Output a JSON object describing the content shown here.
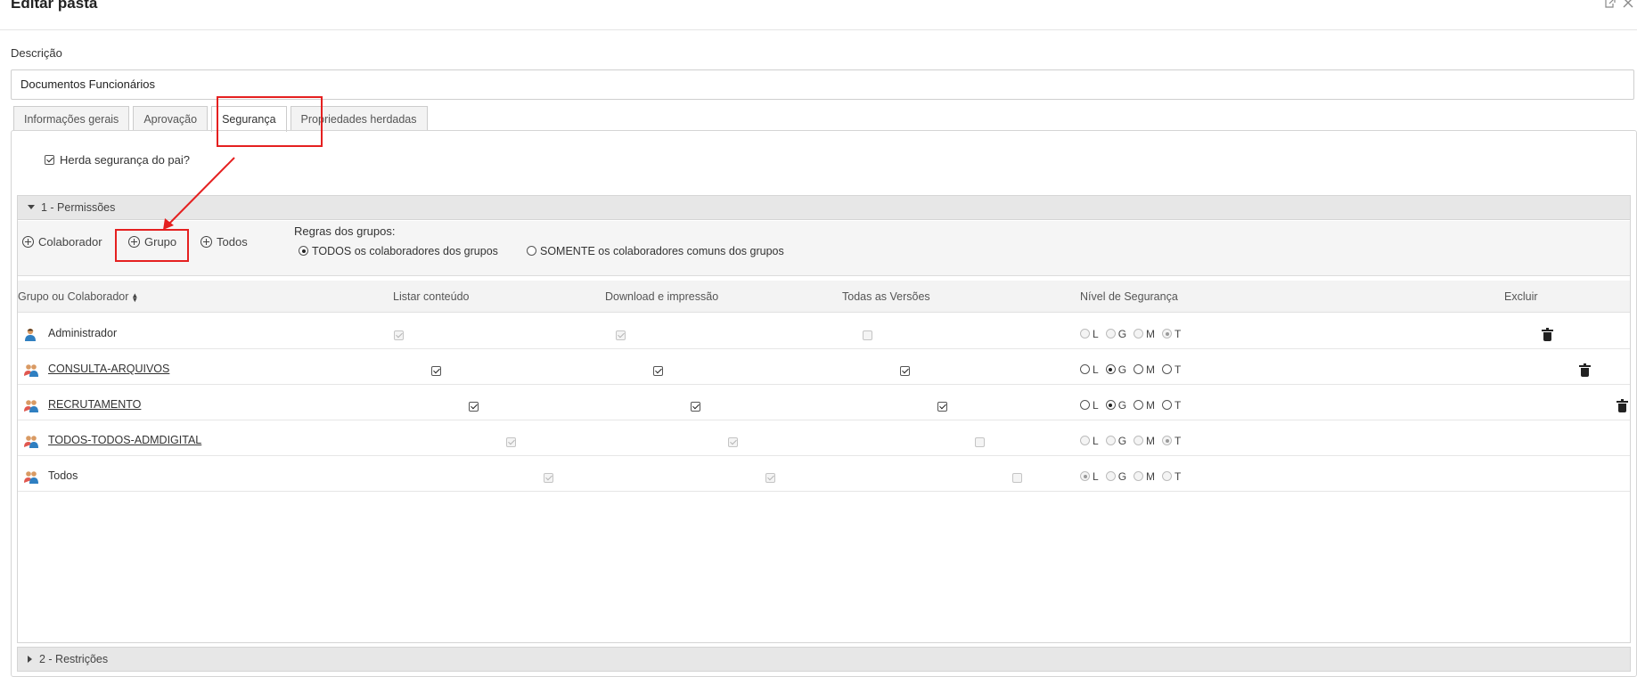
{
  "window": {
    "title": "Editar pasta",
    "icons": [
      "popout-icon",
      "close-icon"
    ]
  },
  "description": {
    "label": "Descrição",
    "value": "Documentos Funcionários"
  },
  "tabs": [
    {
      "label": "Informações gerais",
      "active": false
    },
    {
      "label": "Aprovação",
      "active": false
    },
    {
      "label": "Segurança",
      "active": true
    },
    {
      "label": "Propriedades herdadas",
      "active": false
    }
  ],
  "inherit": {
    "label": "Herda segurança do pai?",
    "checked": true
  },
  "permissions": {
    "section_title": "1 - Permissões",
    "add_buttons": {
      "collaborator": "Colaborador",
      "group": "Grupo",
      "all": "Todos"
    },
    "rules": {
      "label": "Regras dos grupos:",
      "options": [
        {
          "label": "TODOS os colaboradores dos grupos",
          "selected": true
        },
        {
          "label": "SOMENTE os colaboradores comuns dos grupos",
          "selected": false
        }
      ]
    },
    "columns": {
      "name": "Grupo ou Colaborador",
      "list": "Listar conteúdo",
      "download": "Download e impressão",
      "versions": "Todas as Versões",
      "level": "Nível de Segurança",
      "delete": "Excluir"
    },
    "level_letters": [
      "L",
      "G",
      "M",
      "T"
    ],
    "rows": [
      {
        "name": "Administrador",
        "type": "user",
        "link": false,
        "list": true,
        "download": true,
        "versions": false,
        "level": "T",
        "disabled": true
      },
      {
        "name": "CONSULTA-ARQUIVOS",
        "type": "group",
        "link": true,
        "list": true,
        "download": true,
        "versions": true,
        "level": "G",
        "disabled": false
      },
      {
        "name": "RECRUTAMENTO",
        "type": "group",
        "link": true,
        "list": true,
        "download": true,
        "versions": true,
        "level": "G",
        "disabled": false
      },
      {
        "name": "TODOS-TODOS-ADMDIGITAL",
        "type": "group",
        "link": true,
        "list": true,
        "download": true,
        "versions": false,
        "level": "T",
        "disabled": true
      },
      {
        "name": "Todos",
        "type": "group",
        "link": false,
        "list": true,
        "download": true,
        "versions": false,
        "level": "L",
        "disabled": true
      }
    ]
  },
  "restrictions": {
    "section_title": "2 - Restrições"
  },
  "colors": {
    "highlight": "#e52020",
    "section_bg": "#e7e7e7",
    "toolbar_bg": "#f5f5f5"
  }
}
